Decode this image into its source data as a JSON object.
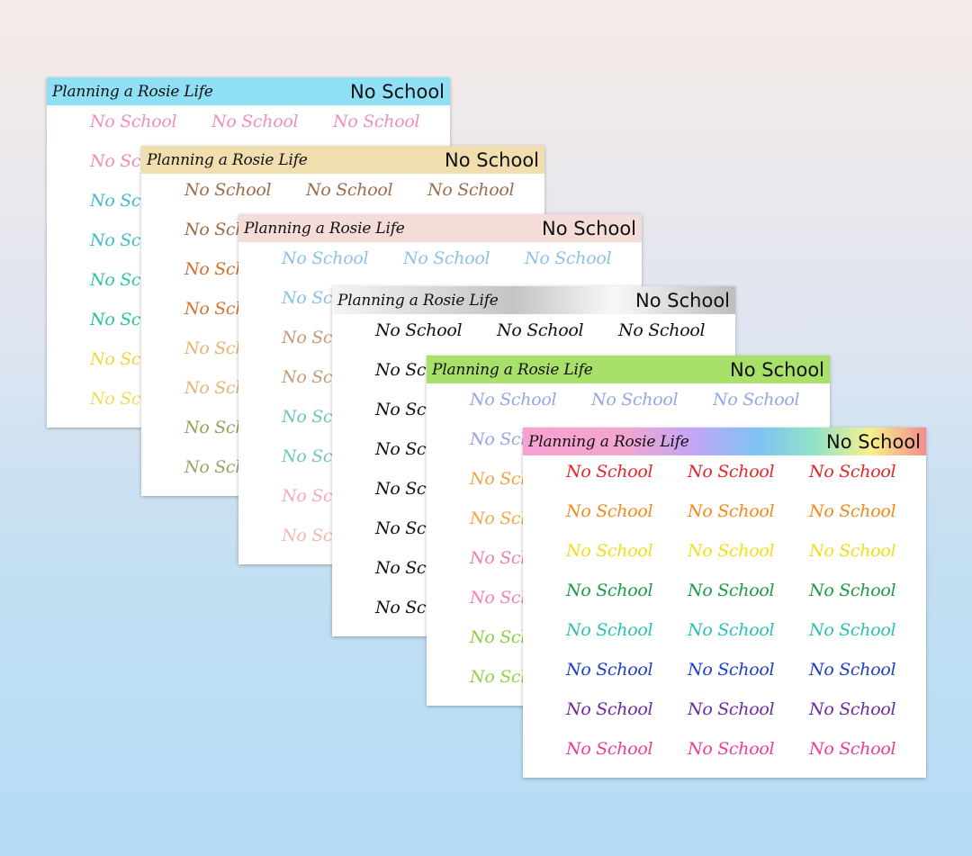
{
  "brand": "Planning a Rosie Life",
  "title": "No School",
  "sticker_text": "No School",
  "sheets": [
    {
      "header_background": "#8fdff5",
      "rows": [
        [
          "#f08fbd",
          "#f08fbd",
          "#f08fbd"
        ],
        [
          "#f58bb0",
          "#f58bb0",
          "#f58bb0"
        ],
        [
          "#45b8d4",
          "#45b8d4",
          "#45b8d4"
        ],
        [
          "#40bcd0",
          "#40bcd0",
          "#40bcd0"
        ],
        [
          "#2fc6a0",
          "#2fc6a0",
          "#2fc6a0"
        ],
        [
          "#28c49a",
          "#28c49a",
          "#28c49a"
        ],
        [
          "#f0d640",
          "#f0d640",
          "#f0d640"
        ],
        [
          "#f4dc55",
          "#f4dc55",
          "#f4dc55"
        ]
      ]
    },
    {
      "header_background": "#f1deae",
      "rows": [
        [
          "#9c6d4b",
          "#9c6d4b",
          "#9c6d4b"
        ],
        [
          "#a06a46",
          "#a06a46",
          "#a06a46"
        ],
        [
          "#d06f2c",
          "#d06f2c",
          "#d06f2c"
        ],
        [
          "#d57432",
          "#d57432",
          "#d57432"
        ],
        [
          "#ebb46c",
          "#ebb46c",
          "#ebb46c"
        ],
        [
          "#e6b57a",
          "#e6b57a",
          "#e6b57a"
        ],
        [
          "#92a35a",
          "#92a35a",
          "#92a35a"
        ],
        [
          "#94a667",
          "#94a667",
          "#94a667"
        ]
      ]
    },
    {
      "header_background": "#f4ddd8",
      "rows": [
        [
          "#8cc2ea",
          "#8cc2ea",
          "#8cc2ea"
        ],
        [
          "#8ac0e8",
          "#8ac0e8",
          "#8ac0e8"
        ],
        [
          "#c59a74",
          "#c59a74",
          "#c59a74"
        ],
        [
          "#c69b76",
          "#c69b76",
          "#c69b76"
        ],
        [
          "#6ec6bd",
          "#6ec6bd",
          "#6ec6bd"
        ],
        [
          "#71c7be",
          "#71c7be",
          "#71c7be"
        ],
        [
          "#f2aeb4",
          "#f2aeb4",
          "#f2aeb4"
        ],
        [
          "#f4b8ad",
          "#f4b8ad",
          "#f4b8ad"
        ]
      ]
    },
    {
      "header_background": "linear-gradient(90deg,#f4f4f4 0%,#c4c4c4 45%,#f8f8f8 70%,#bdbdbd 100%)",
      "rows": [
        [
          "#111111",
          "#111111",
          "#111111"
        ],
        [
          "#111111",
          "#111111",
          "#111111"
        ],
        [
          "#111111",
          "#111111",
          "#111111"
        ],
        [
          "#111111",
          "#111111",
          "#111111"
        ],
        [
          "#111111",
          "#111111",
          "#111111"
        ],
        [
          "#111111",
          "#111111",
          "#111111"
        ],
        [
          "#111111",
          "#111111",
          "#111111"
        ],
        [
          "#111111",
          "#111111",
          "#111111"
        ]
      ]
    },
    {
      "header_background": "#a9e06a",
      "rows": [
        [
          "#93a8e4",
          "#93a8e4",
          "#93a8e4"
        ],
        [
          "#93a8e4",
          "#93a8e4",
          "#93a8e4"
        ],
        [
          "#f0a640",
          "#f0a640",
          "#f0a640"
        ],
        [
          "#f1a848",
          "#f1a848",
          "#f1a848"
        ],
        [
          "#f37fb0",
          "#f37fb0",
          "#f37fb0"
        ],
        [
          "#f484b3",
          "#f484b3",
          "#f484b3"
        ],
        [
          "#8dd03e",
          "#8dd03e",
          "#8dd03e"
        ],
        [
          "#93d34a",
          "#93d34a",
          "#93d34a"
        ]
      ]
    },
    {
      "header_background": "linear-gradient(90deg,#f7a1d2 0%,#f3a6cf 25%,#c3a6f6 42%,#7ec2f5 58%,#8fe3c8 72%,#f6f18c 86%,#f48d8a 100%)",
      "rows": [
        [
          "#e3262b",
          "#e3262b",
          "#e3262b"
        ],
        [
          "#f08a1c",
          "#f08a1c",
          "#f08a1c"
        ],
        [
          "#f2dd1a",
          "#f2dd1a",
          "#f2dd1a"
        ],
        [
          "#1a9a4a",
          "#1a9a4a",
          "#1a9a4a"
        ],
        [
          "#2bbfb5",
          "#2bbfb5",
          "#2bbfb5"
        ],
        [
          "#1d3ec8",
          "#1d3ec8",
          "#1d3ec8"
        ],
        [
          "#6b2aa0",
          "#6b2aa0",
          "#6b2aa0"
        ],
        [
          "#ea3f8e",
          "#ea3f8e",
          "#ea3f8e"
        ]
      ]
    }
  ]
}
